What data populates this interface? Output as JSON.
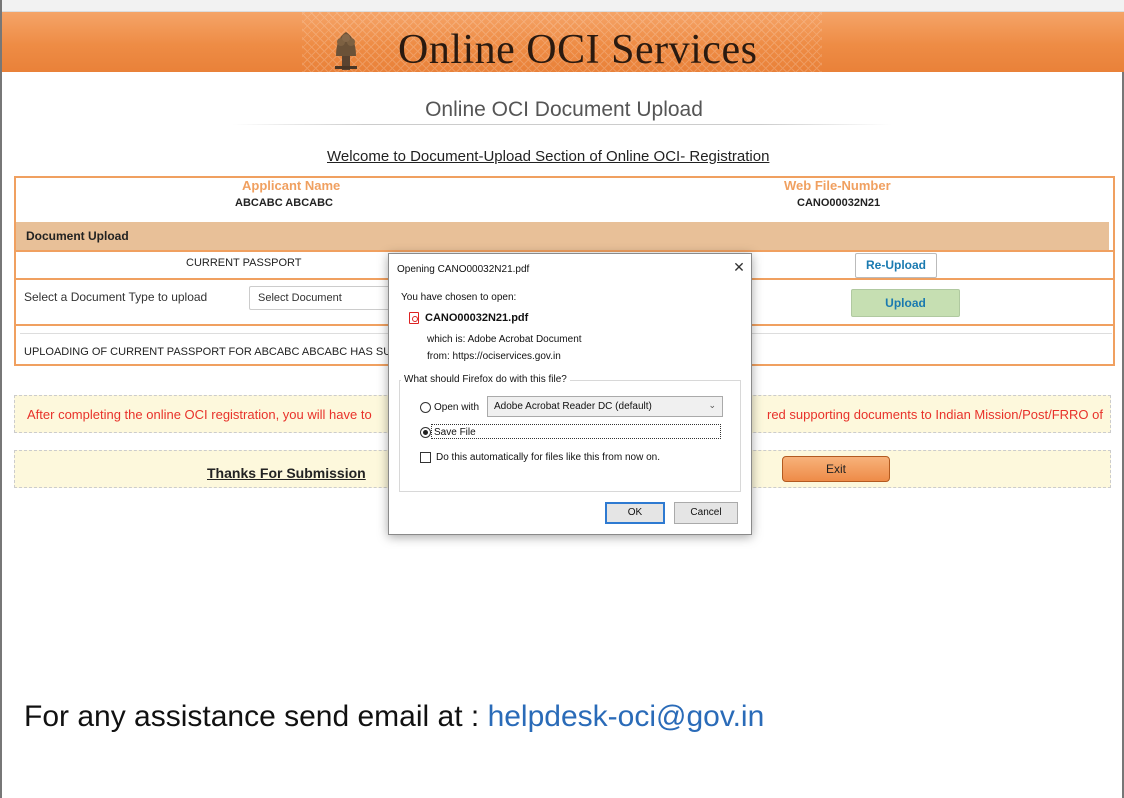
{
  "banner": {
    "title": "Online OCI Services",
    "emblem_icon": "national-emblem-icon"
  },
  "page": {
    "heading": "Online OCI Document Upload",
    "welcome": "Welcome to Document-Upload Section of Online OCI- Registration"
  },
  "applicant": {
    "name_label": "Applicant Name",
    "name_value": "ABCABC ABCABC",
    "file_label": "Web File-Number",
    "file_value": "CANO00032N21"
  },
  "document_upload": {
    "header": "Document Upload",
    "current_doc": "CURRENT PASSPORT",
    "reupload_label": "Re-Upload",
    "select_label": "Select a Document Type to upload",
    "select_value": "Select Document",
    "upload_label": "Upload",
    "success_message": "UPLOADING OF CURRENT PASSPORT FOR ABCABC ABCABC HAS SUCCESSF"
  },
  "notice": {
    "left_text": "After completing the online OCI registration, you will have to",
    "right_text": "red supporting documents to Indian Mission/Post/FRRO of"
  },
  "footer": {
    "thanks": "Thanks For Submission",
    "exit_label": "Exit",
    "assist_text": "For any assistance send email at : ",
    "assist_email": "helpdesk-oci@gov.in"
  },
  "dialog": {
    "title": "Opening CANO00032N21.pdf",
    "close": "✕",
    "chosen": "You have chosen to open:",
    "file_name": "CANO00032N21.pdf",
    "which_is": "which is:  Adobe Acrobat Document",
    "from": "from:  https://ociservices.gov.in",
    "question": "What should Firefox do with this file?",
    "open_with_label": "Open with",
    "open_with_app": "Adobe Acrobat Reader DC  (default)",
    "save_file_label": "Save File",
    "auto_label": "Do this automatically for files like this from now on.",
    "ok_label": "OK",
    "cancel_label": "Cancel",
    "open_with_selected": false,
    "save_file_selected": true,
    "auto_checked": false
  }
}
